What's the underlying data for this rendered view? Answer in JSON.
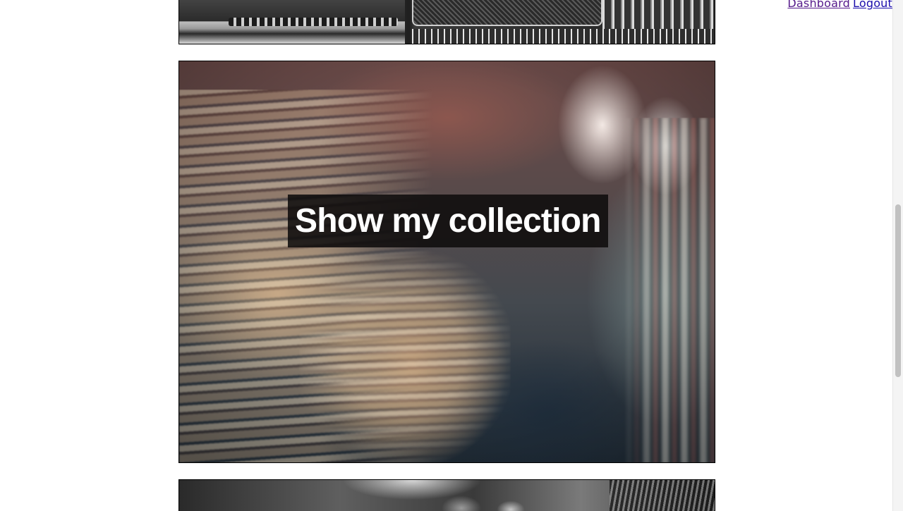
{
  "nav": {
    "dashboard_label": "Dashboard",
    "logout_label": "Logout"
  },
  "tiles": {
    "top": {
      "image_icon": "stereo-amplifier-photo"
    },
    "main": {
      "image_icon": "bookshelves-photo",
      "caption": "Show my collection"
    },
    "bottom": {
      "image_icon": "typewriter-photo"
    }
  },
  "colors": {
    "link": "#1a0dab",
    "link_visited": "#551a8b",
    "caption_bg": "#0f0c0c",
    "caption_text": "#ffffff",
    "tile_border": "#000000"
  }
}
